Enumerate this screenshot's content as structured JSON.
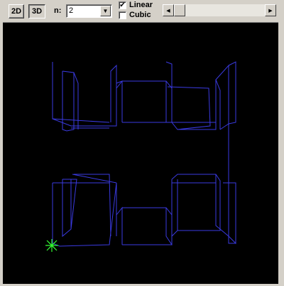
{
  "toolbar": {
    "btn_2d": "2D",
    "btn_3d": "3D",
    "n_label": "n:",
    "n_value": "2",
    "linear_label": "Linear",
    "linear_checked": true,
    "cubic_label": "Cubic",
    "cubic_checked": false
  },
  "colors": {
    "curve": "#3a3ae0",
    "marker": "#33ff33",
    "background": "#000000"
  }
}
